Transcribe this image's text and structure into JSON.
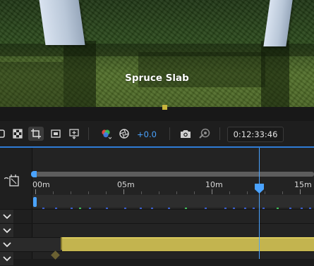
{
  "viewport": {
    "object_label": "Spruce Slab"
  },
  "toolbar": {
    "velocity": "+0.0",
    "timecode": "0:12:33:46",
    "icons": [
      "view-mode-icon",
      "checker-grid-icon",
      "crop-frame-icon",
      "safe-frame-icon",
      "move-frame-icon",
      "color-channels-icon",
      "motion-blur-icon",
      "camera-icon",
      "render-icon"
    ]
  },
  "timeline": {
    "ticks": [
      "00m",
      "05m",
      "10m",
      "15m"
    ],
    "playhead_time": "12m 33s",
    "accent_color": "#4aa3ff",
    "clip_color": "#c3b44f"
  }
}
